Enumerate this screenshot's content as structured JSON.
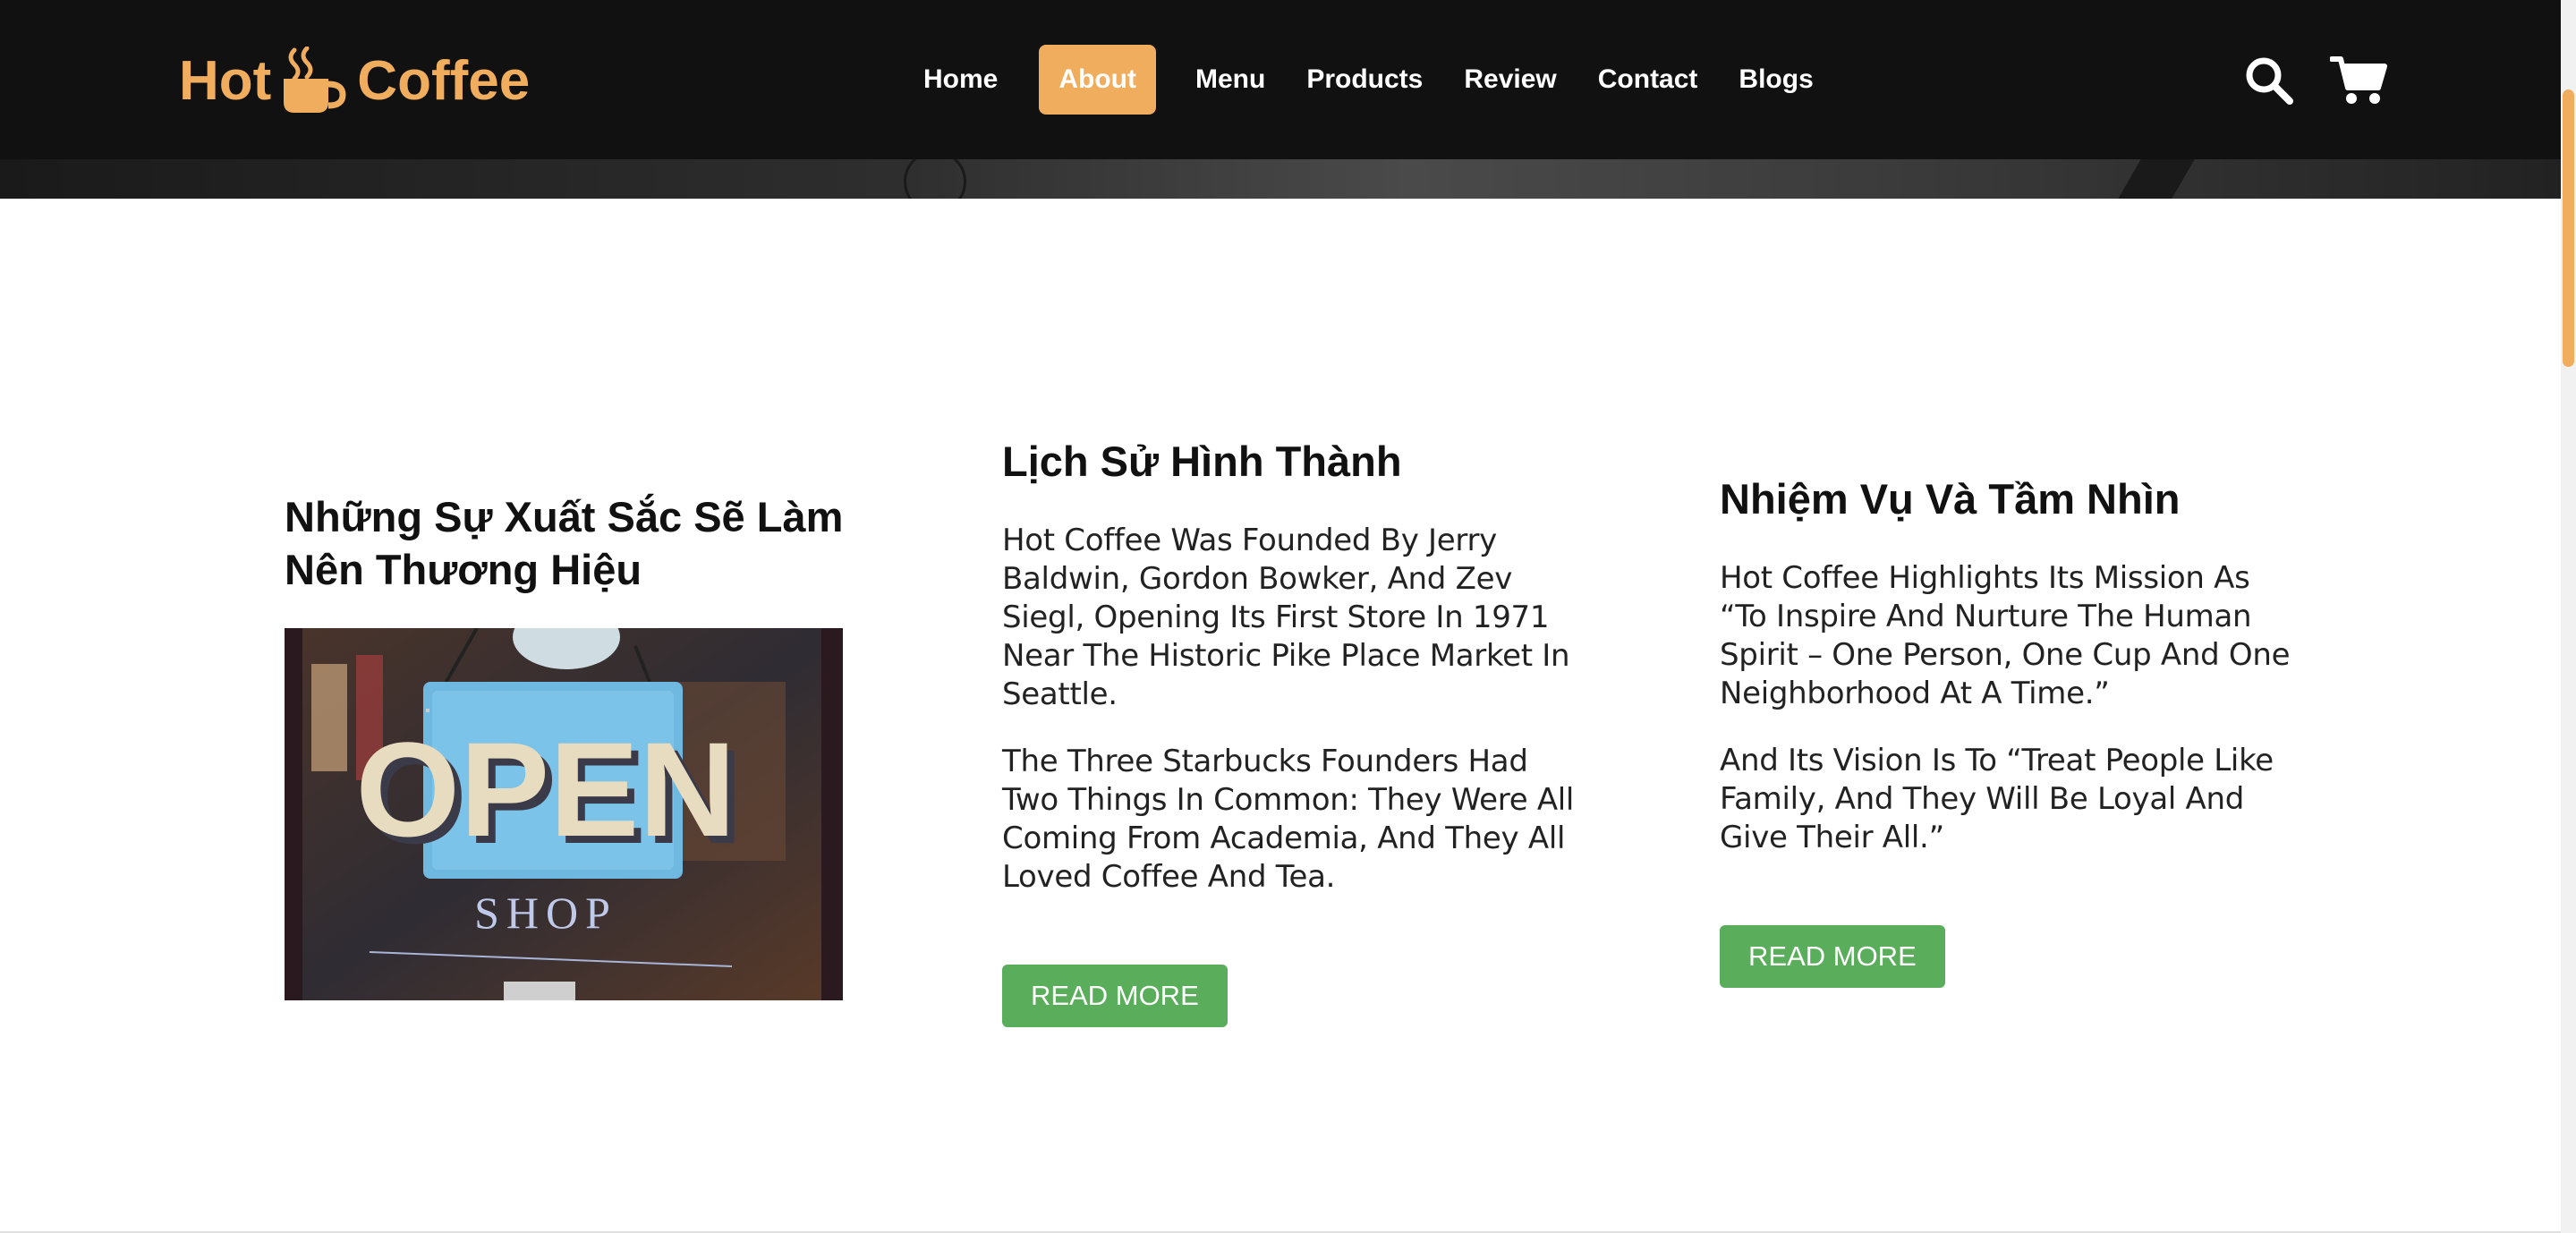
{
  "header": {
    "logo_left": "Hot",
    "logo_right": "Coffee",
    "nav": [
      {
        "label": "Home",
        "active": false
      },
      {
        "label": "About",
        "active": true
      },
      {
        "label": "Menu",
        "active": false
      },
      {
        "label": "Products",
        "active": false
      },
      {
        "label": "Review",
        "active": false
      },
      {
        "label": "Contact",
        "active": false
      },
      {
        "label": "Blogs",
        "active": false
      }
    ],
    "icons": [
      "search-icon",
      "cart-icon"
    ]
  },
  "colors": {
    "accent": "#f0ad5e",
    "header_bg": "#111111",
    "button_green": "#5aad5a"
  },
  "main": {
    "col1": {
      "title": "Những Sự Xuất Sắc Sẽ Làm Nên Thương Hiệu",
      "image_sign_text": "OPEN",
      "image_sub_text": "SHOP"
    },
    "col2": {
      "title": "Lịch Sử Hình Thành",
      "paragraphs": [
        "Hot Coffee Was Founded By Jerry Baldwin, Gordon Bowker, And Zev Siegl, Opening Its First Store In 1971 Near The Historic Pike Place Market In Seattle.",
        "The Three Starbucks Founders Had Two Things In Common: They Were All Coming From Academia, And They All Loved Coffee And Tea."
      ],
      "button": "READ MORE"
    },
    "col3": {
      "title": "Nhiệm Vụ Và Tầm Nhìn",
      "paragraphs": [
        "Hot Coffee Highlights Its Mission As “To Inspire And Nurture The Human Spirit – One Person, One Cup And One Neighborhood At A Time.”",
        "And Its Vision Is To “Treat People Like Family, And They Will Be Loyal And Give Their All.”"
      ],
      "button": "READ MORE"
    }
  }
}
